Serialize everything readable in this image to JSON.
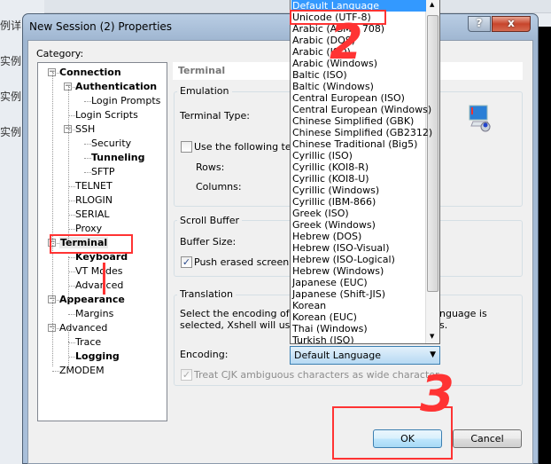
{
  "background": {
    "texts": [
      "例详",
      "实例",
      "实例",
      "实例"
    ]
  },
  "dialog": {
    "title": "New Session (2) Properties",
    "help_label": "?",
    "close_label": "x",
    "category_label": "Category:",
    "tree": [
      {
        "label": "Connection",
        "bold": true,
        "level": 0,
        "expander": "−"
      },
      {
        "label": "Authentication",
        "bold": true,
        "level": 1,
        "expander": "−"
      },
      {
        "label": "Login Prompts",
        "bold": false,
        "level": 2
      },
      {
        "label": "Login Scripts",
        "bold": false,
        "level": 1
      },
      {
        "label": "SSH",
        "bold": false,
        "level": 1,
        "expander": "−"
      },
      {
        "label": "Security",
        "bold": false,
        "level": 2
      },
      {
        "label": "Tunneling",
        "bold": true,
        "level": 2
      },
      {
        "label": "SFTP",
        "bold": false,
        "level": 2
      },
      {
        "label": "TELNET",
        "bold": false,
        "level": 1
      },
      {
        "label": "RLOGIN",
        "bold": false,
        "level": 1
      },
      {
        "label": "SERIAL",
        "bold": false,
        "level": 1
      },
      {
        "label": "Proxy",
        "bold": false,
        "level": 1
      },
      {
        "label": "Terminal",
        "bold": true,
        "level": 0,
        "expander": "−",
        "selected": true
      },
      {
        "label": "Keyboard",
        "bold": true,
        "level": 1
      },
      {
        "label": "VT Modes",
        "bold": false,
        "level": 1
      },
      {
        "label": "Advanced",
        "bold": false,
        "level": 1
      },
      {
        "label": "Appearance",
        "bold": true,
        "level": 0,
        "expander": "−"
      },
      {
        "label": "Margins",
        "bold": false,
        "level": 1
      },
      {
        "label": "Advanced",
        "bold": false,
        "level": 0,
        "expander": "−"
      },
      {
        "label": "Trace",
        "bold": false,
        "level": 1
      },
      {
        "label": "Logging",
        "bold": true,
        "level": 1
      },
      {
        "label": "ZMODEM",
        "bold": false,
        "level": 0
      }
    ],
    "panel": {
      "title": "Terminal",
      "emulation": {
        "group": "Emulation",
        "terminal_type_label": "Terminal Type:",
        "use_following_label": "Use the following term",
        "use_following_checked": false,
        "rows_label": "Rows:",
        "columns_label": "Columns:"
      },
      "scroll_buffer": {
        "group": "Scroll Buffer",
        "buffer_size_label": "Buffer Size:",
        "push_erased_label": "Push erased screen int",
        "push_erased_checked": true
      },
      "translation": {
        "group": "Translation",
        "desc_line1": "Select the encoding of the",
        "desc_line1_end": "nguage is",
        "desc_line2": "selected, Xshell will use th",
        "desc_line2_end": "s.",
        "encoding_label": "Encoding:",
        "encoding_value": "Default Language",
        "treat_cjk_label": "Treat CJK ambiguous characters as wide character",
        "treat_cjk_checked": true,
        "treat_cjk_disabled": true
      }
    },
    "ok_label": "OK",
    "cancel_label": "Cancel"
  },
  "encoding_options": [
    "Default Language",
    "Unicode (UTF-8)",
    "Arabic (ASMO 708)",
    "Arabic (DOS)",
    "Arabic (ISO)",
    "Arabic (Windows)",
    "Baltic (ISO)",
    "Baltic (Windows)",
    "Central European (ISO)",
    "Central European (Windows)",
    "Chinese Simplified (GBK)",
    "Chinese Simplified (GB2312)",
    "Chinese Traditional (Big5)",
    "Cyrillic (ISO)",
    "Cyrillic (KOI8-R)",
    "Cyrillic (KOI8-U)",
    "Cyrillic (Windows)",
    "Cyrillic (IBM-866)",
    "Greek (ISO)",
    "Greek (Windows)",
    "Hebrew (DOS)",
    "Hebrew (ISO-Visual)",
    "Hebrew (ISO-Logical)",
    "Hebrew (Windows)",
    "Japanese (EUC)",
    "Japanese (Shift-JIS)",
    "Korean",
    "Korean (EUC)",
    "Thai (Windows)",
    "Turkish (ISO)"
  ],
  "encoding_selected_index": 0,
  "annotations": {
    "color": "#ff3333",
    "step2": "2",
    "step3": "3"
  }
}
